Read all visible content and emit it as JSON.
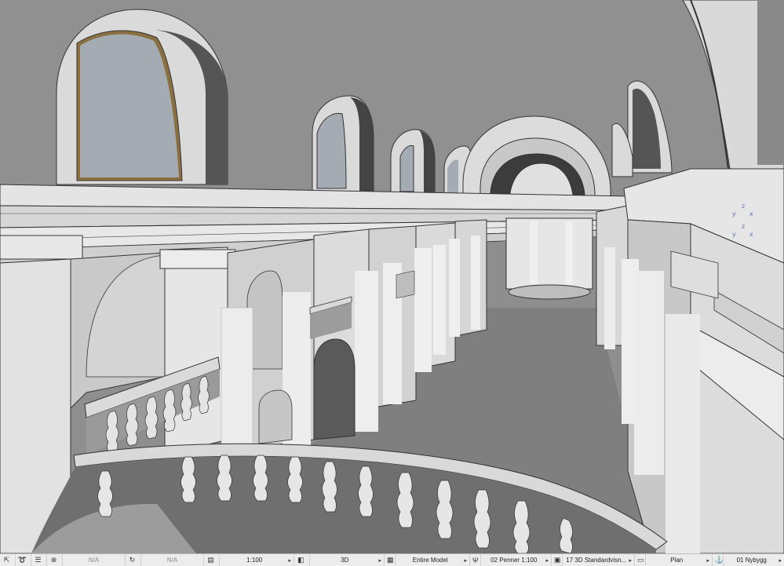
{
  "viewport": {
    "axis_top": {
      "z": "z",
      "x": "x",
      "y": "y"
    },
    "axis_bottom": {
      "z": "z",
      "x": "x",
      "y": "y"
    }
  },
  "statusbar": {
    "coord_a": "N/A",
    "coord_b": "N/A",
    "scale": "1:100",
    "view_mode": "3D",
    "model_filter": "Entire Model",
    "pen_set": "02 Penner 1:100",
    "view_setting": "17 3D Standardvisn...",
    "plan": "Plan",
    "renovation": "01 Nybygg",
    "icons": {
      "arrow": "arrow-cursor-icon",
      "lasso": "lasso-icon",
      "walk": "walk-icon",
      "zoom": "zoom-fit-icon",
      "orbit": "orbit-icon",
      "layers": "layers-icon",
      "cube": "cube-icon",
      "pen": "pen-icon",
      "model": "model-icon",
      "view": "view-icon",
      "plan": "plan-icon",
      "reno": "renovation-icon"
    }
  }
}
